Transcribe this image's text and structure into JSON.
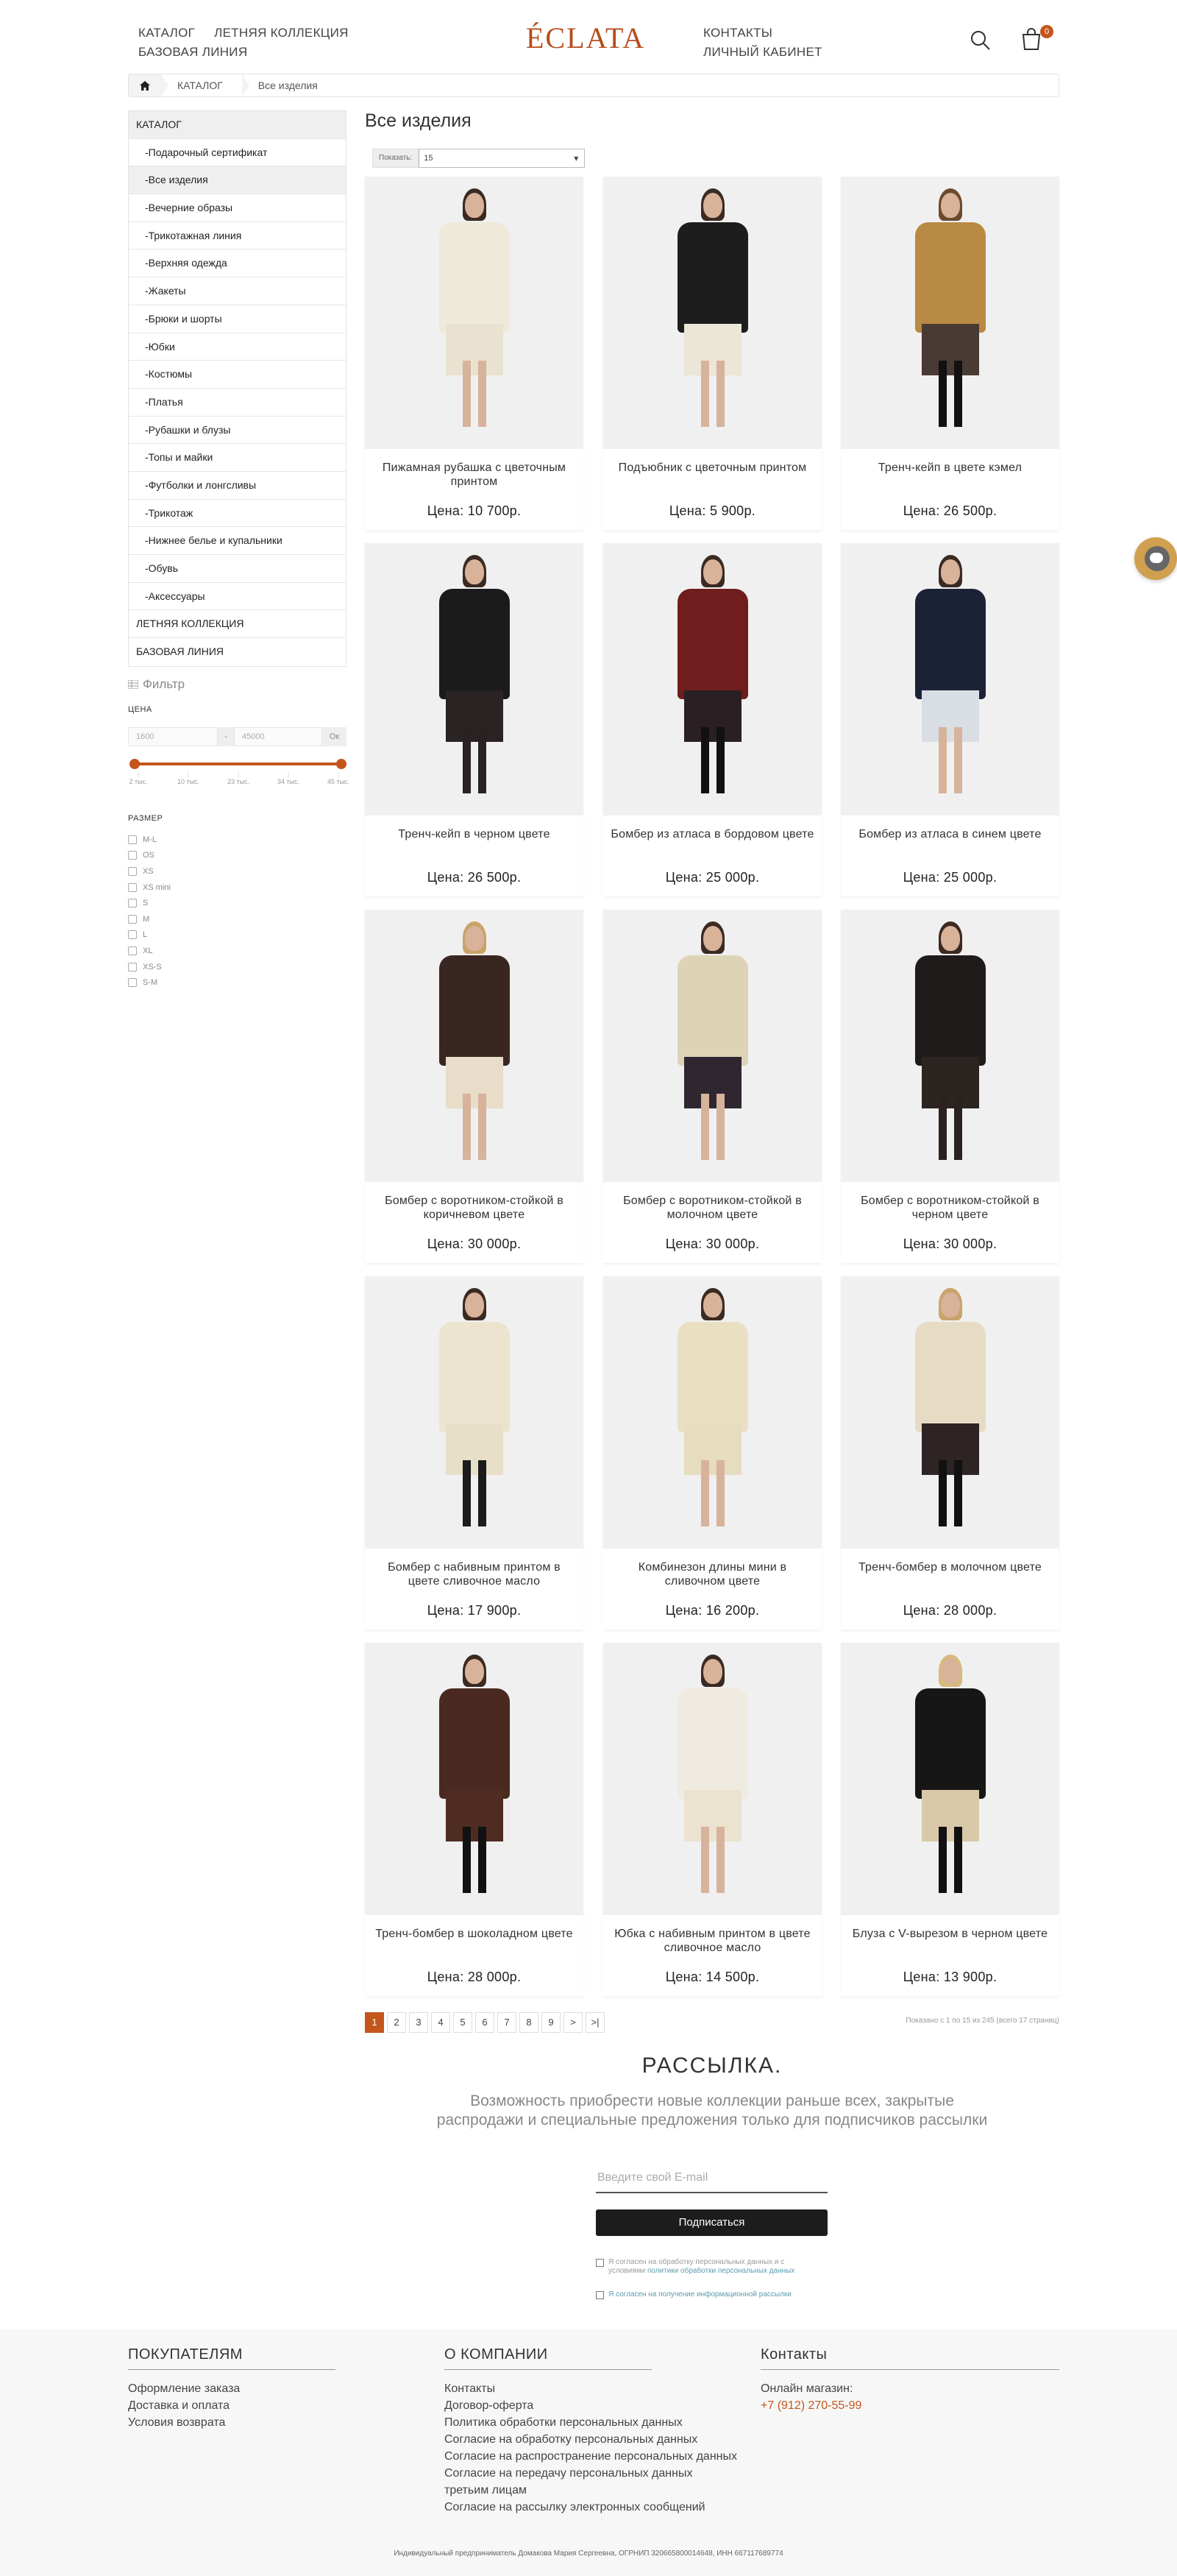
{
  "header": {
    "nav_left": [
      "КАТАЛОГ",
      "ЛЕТНЯЯ КОЛЛЕКЦИЯ",
      "БАЗОВАЯ ЛИНИЯ"
    ],
    "logo": "ÉCLATA",
    "nav_right": [
      "КОНТАКТЫ",
      "ЛИЧНЫЙ КАБИНЕТ"
    ],
    "cart_count": "0"
  },
  "breadcrumb": [
    "КАТАЛОГ",
    "Все изделия"
  ],
  "sidebar": {
    "categories": [
      {
        "label": "КАТАЛОГ",
        "type": "head"
      },
      {
        "label": "-Подарочный сертификат",
        "type": "sub"
      },
      {
        "label": "-Все изделия",
        "type": "sub active"
      },
      {
        "label": "-Вечерние образы",
        "type": "sub"
      },
      {
        "label": "-Трикотажная линия",
        "type": "sub"
      },
      {
        "label": "-Верхняя одежда",
        "type": "sub"
      },
      {
        "label": "-Жакеты",
        "type": "sub"
      },
      {
        "label": "-Брюки и шорты",
        "type": "sub"
      },
      {
        "label": "-Юбки",
        "type": "sub"
      },
      {
        "label": "-Костюмы",
        "type": "sub"
      },
      {
        "label": "-Платья",
        "type": "sub"
      },
      {
        "label": "-Рубашки и блузы",
        "type": "sub"
      },
      {
        "label": "-Топы и майки",
        "type": "sub"
      },
      {
        "label": "-Футболки и лонгсливы",
        "type": "sub"
      },
      {
        "label": "-Трикотаж",
        "type": "sub"
      },
      {
        "label": "-Нижнее белье и купальники",
        "type": "sub"
      },
      {
        "label": "-Обувь",
        "type": "sub"
      },
      {
        "label": "-Аксессуары",
        "type": "sub"
      },
      {
        "label": "ЛЕТНЯЯ КОЛЛЕКЦИЯ",
        "type": ""
      },
      {
        "label": "БАЗОВАЯ ЛИНИЯ",
        "type": ""
      }
    ],
    "filter_title": "Фильтр",
    "price_label": "ЦЕНА",
    "price_from": "1600",
    "price_to": "45000",
    "price_dash": "-",
    "price_ok": "Ок",
    "price_range": [
      0,
      1
    ],
    "ticks": [
      "2 тыс.",
      "10 тыс.",
      "23 тыс.",
      "34 тыс.",
      "45 тыс."
    ],
    "size_label": "РАЗМЕР",
    "sizes": [
      "M-L",
      "OS",
      "XS",
      "XS mini",
      "S",
      "M",
      "L",
      "XL",
      "XS-S",
      "S-M"
    ]
  },
  "main": {
    "title": "Все изделия",
    "show_label": "Показать:",
    "show_value": "15"
  },
  "products": [
    {
      "name": "Пижамная рубашка с цветочным принтом",
      "price": "Цена: 10 700р."
    },
    {
      "name": "Подъюбник с цветочным принтом",
      "price": "Цена: 5 900р."
    },
    {
      "name": "Тренч-кейп в цвете кэмел",
      "price": "Цена: 26 500р."
    },
    {
      "name": "Тренч-кейп в черном цвете",
      "price": "Цена: 26 500р."
    },
    {
      "name": "Бомбер из атласа в бордовом цвете",
      "price": "Цена: 25 000р."
    },
    {
      "name": "Бомбер из атласа в синем цвете",
      "price": "Цена: 25 000р."
    },
    {
      "name": "Бомбер с воротником-стойкой в коричневом цвете",
      "price": "Цена: 30 000р."
    },
    {
      "name": "Бомбер с воротником-стойкой в молочном цвете",
      "price": "Цена: 30 000р."
    },
    {
      "name": "Бомбер с воротником-стойкой в черном цвете",
      "price": "Цена: 30 000р."
    },
    {
      "name": "Бомбер с набивным принтом в цвете сливочное масло",
      "price": "Цена: 17 900р."
    },
    {
      "name": "Комбинезон длины мини в сливочном цвете",
      "price": "Цена: 16 200р."
    },
    {
      "name": "Тренч-бомбер в молочном цвете",
      "price": "Цена: 28 000р."
    },
    {
      "name": "Тренч-бомбер в шоколадном цвете",
      "price": "Цена: 28 000р."
    },
    {
      "name": "Юбка с набивным принтом в цвете сливочное масло",
      "price": "Цена: 14 500р."
    },
    {
      "name": "Блуза с V-вырезом в черном цвете",
      "price": "Цена: 13 900р."
    }
  ],
  "product_colors": [
    {
      "top": "#efe9da",
      "bottom": "#e9e2d0",
      "hair": "#3a2a22",
      "legs": "#d7b39c"
    },
    {
      "top": "#1d1d1d",
      "bottom": "#ebe6d6",
      "hair": "#3a2a22",
      "legs": "#d7b39c"
    },
    {
      "top": "#b98a43",
      "bottom": "#4a3a34",
      "hair": "#6b4a30",
      "legs": "#111"
    },
    {
      "top": "#1b1b1b",
      "bottom": "#2a2323",
      "hair": "#3a2a22",
      "legs": "#2a2222"
    },
    {
      "top": "#6f1d1d",
      "bottom": "#2a2024",
      "hair": "#3a2a22",
      "legs": "#111"
    },
    {
      "top": "#1c2236",
      "bottom": "#d9dde4",
      "hair": "#3a2a22",
      "legs": "#d7b39c"
    },
    {
      "top": "#3a2620",
      "bottom": "#e8ddc9",
      "hair": "#c9a46a",
      "legs": "#d7b39c"
    },
    {
      "top": "#ddd3b6",
      "bottom": "#2f2630",
      "hair": "#3a2a22",
      "legs": "#d7b39c"
    },
    {
      "top": "#1e1b1a",
      "bottom": "#2c2420",
      "hair": "#3a2a22",
      "legs": "#2b2220"
    },
    {
      "top": "#ece4cf",
      "bottom": "#e8dfc8",
      "hair": "#3a2a22",
      "legs": "#1c1c1c"
    },
    {
      "top": "#e9dfc3",
      "bottom": "#e6dcc0",
      "hair": "#3a2a22",
      "legs": "#d7b39c"
    },
    {
      "top": "#e6dcc4",
      "bottom": "#2e2424",
      "hair": "#c9a46a",
      "legs": "#111"
    },
    {
      "top": "#4a2a20",
      "bottom": "#4f2c22",
      "hair": "#3a2a22",
      "legs": "#111"
    },
    {
      "top": "#f0ebe0",
      "bottom": "#ebe3cf",
      "hair": "#3a2a22",
      "legs": "#d7b39c"
    },
    {
      "top": "#161616",
      "bottom": "#d9c9a8",
      "hair": "#d6b980",
      "legs": "#111"
    }
  ],
  "pagination": {
    "pages": [
      "1",
      "2",
      "3",
      "4",
      "5",
      "6",
      "7",
      "8",
      "9",
      ">",
      ">|"
    ],
    "showing": "Показано с 1 по 15 из 245 (всего 17 страниц)"
  },
  "newsletter": {
    "title": "РАССЫЛКА.",
    "text": "Возможность приобрести новые коллекции раньше всех, закрытые распродажи и специальные предложения только для подписчиков рассылки",
    "email_placeholder": "Введите свой E-mail",
    "button": "Подписаться",
    "consent1_a": "Я согласен на обработку персональных данных и с условиями ",
    "consent1_link": "политики обработки персональных данных",
    "consent2": "Я согласен на получение информационной рассылки"
  },
  "footer": {
    "col1": {
      "title": "ПОКУПАТЕЛЯМ",
      "links": [
        "Оформление заказа",
        "Доставка и оплата",
        "Условия возврата"
      ]
    },
    "col2": {
      "title": "О КОМПАНИИ",
      "links": [
        "Контакты",
        "Договор-оферта",
        "Политика обработки персональных данных",
        "Согласие на обработку персональных данных",
        "Согласие на распространение персональных данных",
        "Согласие на передачу персональных данных третьим лицам",
        "Согласие на рассылку электронных сообщений"
      ]
    },
    "col3": {
      "title": "Контакты",
      "label": "Онлайн магазин:",
      "phone": "+7 (912) 270-55-99"
    },
    "bottom": "Индивидуальный предприниматель Домакова Мария Сергеевна, ОГРНИП 320665800014648, ИНН 667117689774"
  },
  "colors": {
    "accent": "#c4561c",
    "logo": "#b64d1e"
  }
}
